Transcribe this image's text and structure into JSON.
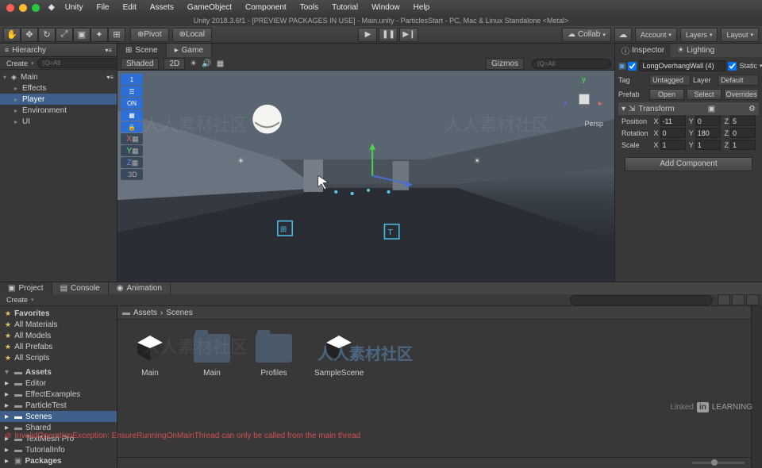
{
  "mac_menu": [
    "Unity",
    "File",
    "Edit",
    "Assets",
    "GameObject",
    "Component",
    "Tools",
    "Tutorial",
    "Window",
    "Help"
  ],
  "window_title": "Unity 2018.3.6f1 - [PREVIEW PACKAGES IN USE] - Main.unity - ParticlesStart - PC, Mac & Linux Standalone <Metal>",
  "toolbar": {
    "pivot": "Pivot",
    "local": "Local",
    "collab": "Collab",
    "account": "Account",
    "layers": "Layers",
    "layout": "Layout"
  },
  "hierarchy": {
    "title": "Hierarchy",
    "create": "Create",
    "search_placeholder": "(Q=All",
    "root": "Main",
    "items": [
      "Effects",
      "Player",
      "Environment",
      "UI"
    ],
    "selected_index": 1
  },
  "scene": {
    "tabs": [
      "Scene",
      "Game"
    ],
    "shading": "Shaded",
    "mode_2d": "2D",
    "gizmos": "Gizmos",
    "search_placeholder": "(Q=All",
    "viewport_tools": [
      "1",
      "",
      "ON",
      "",
      ""
    ],
    "axis_labels": [
      "X",
      "Y",
      "Z",
      "3D"
    ],
    "persp": "Persp",
    "gizmo_axes": {
      "x": "x",
      "y": "y",
      "z": "z"
    }
  },
  "inspector": {
    "tabs": [
      "Inspector",
      "Lighting"
    ],
    "object_name": "LongOverhangWall (4)",
    "static": "Static",
    "tag_label": "Tag",
    "tag_value": "Untagged",
    "layer_label": "Layer",
    "layer_value": "Default",
    "prefab_label": "Prefab",
    "prefab_open": "Open",
    "prefab_select": "Select",
    "prefab_overrides": "Overrides",
    "transform": {
      "title": "Transform",
      "position": {
        "label": "Position",
        "x": "-11",
        "y": "0",
        "z": "5"
      },
      "rotation": {
        "label": "Rotation",
        "x": "0",
        "y": "180",
        "z": "0"
      },
      "scale": {
        "label": "Scale",
        "x": "1",
        "y": "1",
        "z": "1"
      }
    },
    "add_component": "Add Component"
  },
  "project": {
    "tabs": [
      "Project",
      "Console",
      "Animation"
    ],
    "create": "Create",
    "favorites": "Favorites",
    "fav_items": [
      "All Materials",
      "All Models",
      "All Prefabs",
      "All Scripts"
    ],
    "assets_root": "Assets",
    "folders": [
      "Editor",
      "EffectExamples",
      "ParticleTest",
      "Scenes",
      "Shared",
      "TextMesh Pro",
      "TutorialInfo"
    ],
    "packages": "Packages",
    "selected_folder_index": 3,
    "breadcrumb": [
      "Assets",
      "Scenes"
    ],
    "grid_items": [
      {
        "name": "Main",
        "type": "scene"
      },
      {
        "name": "Main",
        "type": "folder"
      },
      {
        "name": "Profiles",
        "type": "folder"
      },
      {
        "name": "SampleScene",
        "type": "scene"
      }
    ]
  },
  "status": {
    "error": "InvalidOperationException: EnsureRunningOnMainThread can only be called from the main thread"
  },
  "watermark_text": "人人素材社区",
  "linkedin": "LEARNING"
}
